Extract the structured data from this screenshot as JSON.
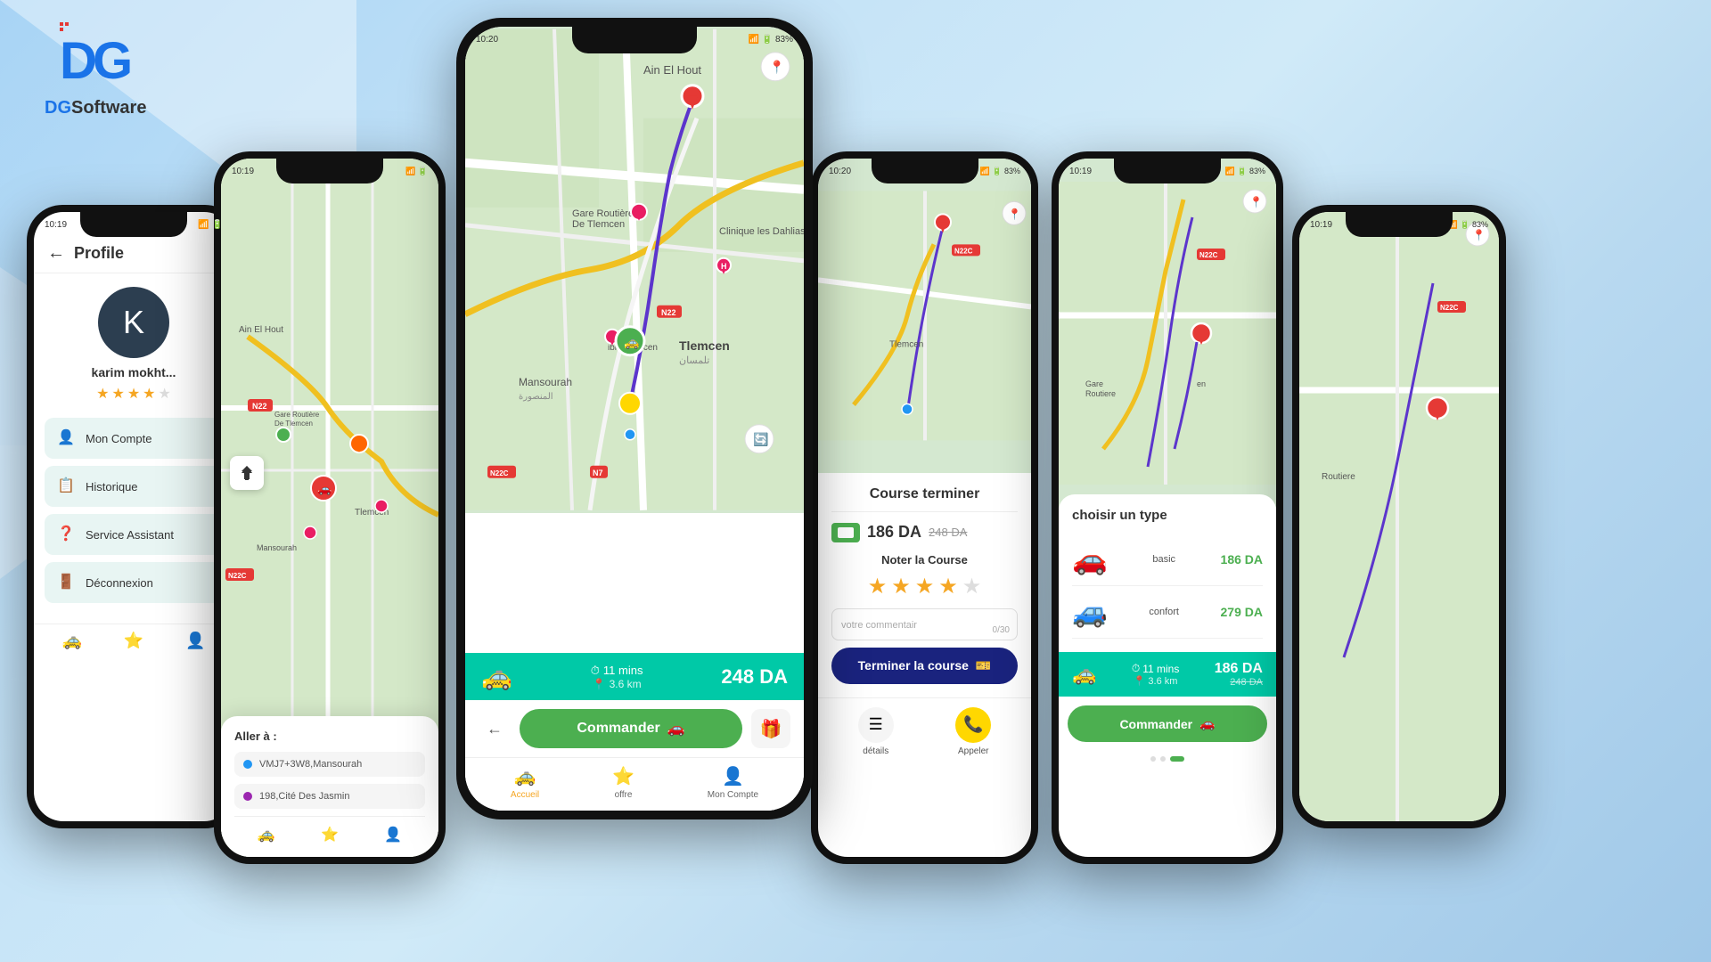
{
  "app": {
    "name": "DGSoftware",
    "logo_letters": "DG"
  },
  "phone_profile": {
    "status_time": "10:19",
    "title": "Profile",
    "avatar_letter": "K",
    "user_name": "karim mokht...",
    "rating": 4,
    "max_rating": 5,
    "menu": [
      {
        "icon": "👤",
        "label": "Mon Compte"
      },
      {
        "icon": "📋",
        "label": "Historique"
      },
      {
        "icon": "❓",
        "label": "Service Assistant"
      },
      {
        "icon": "🚪",
        "label": "Déconnexion"
      }
    ]
  },
  "phone_map1": {
    "status_time": "10:19",
    "destination_label": "Aller à :",
    "destination1": "VMJ7+3W8,Mansourah",
    "destination2": "198,Cité Des Jasmin"
  },
  "phone_main": {
    "status_time": "10:20",
    "map_label1": "Ain El Hout",
    "map_label2": "Gare Routière De Tlemcen",
    "map_label3": "Tlemcen",
    "map_label4": "Mansourah",
    "ride_time": "11 mins",
    "ride_distance": "3.6 km",
    "ride_price": "248 DA",
    "commander_label": "Commander",
    "nav_tabs": [
      {
        "icon": "🚕",
        "label": "Accueil",
        "active": true
      },
      {
        "icon": "⭐",
        "label": "offre",
        "active": false
      },
      {
        "icon": "👤",
        "label": "Mon Compte",
        "active": false
      }
    ]
  },
  "phone_course": {
    "status_time": "10:20",
    "title": "Course terminer",
    "price_main": "186 DA",
    "price_original": "248 DA",
    "noter_label": "Noter la Course",
    "rating": 4,
    "max_rating": 5,
    "comment_placeholder": "votre commentair",
    "comment_count": "0/30",
    "terminer_label": "Terminer la course",
    "footer_buttons": [
      {
        "icon": "☰",
        "label": "détails"
      },
      {
        "icon": "📞",
        "label": "Appeler"
      }
    ]
  },
  "phone_type": {
    "status_time": "10:19",
    "panel_title": "choisir un type",
    "types": [
      {
        "name": "basic",
        "icon": "🚗",
        "price": "186 DA"
      },
      {
        "name": "confort",
        "icon": "🚙",
        "price": "279 DA"
      }
    ],
    "ride_time": "11 mins",
    "ride_distance": "3.6 km",
    "ride_price": "186 DA",
    "ride_price_sub": "248 DA",
    "commander_label": "Commander"
  },
  "map_places": {
    "ain_el_hout": "Ain El Hout",
    "gare_routiere": "Gare Routière De Tlemcen",
    "tlemcen": "Tlemcen تلمسان",
    "mansourah": "Mansourah المنصورة",
    "clinique": "Clinique les Dahlias",
    "ibis": "ibis Tlemcen",
    "n22": "N22",
    "n22c": "N22C",
    "n7": "N7"
  }
}
